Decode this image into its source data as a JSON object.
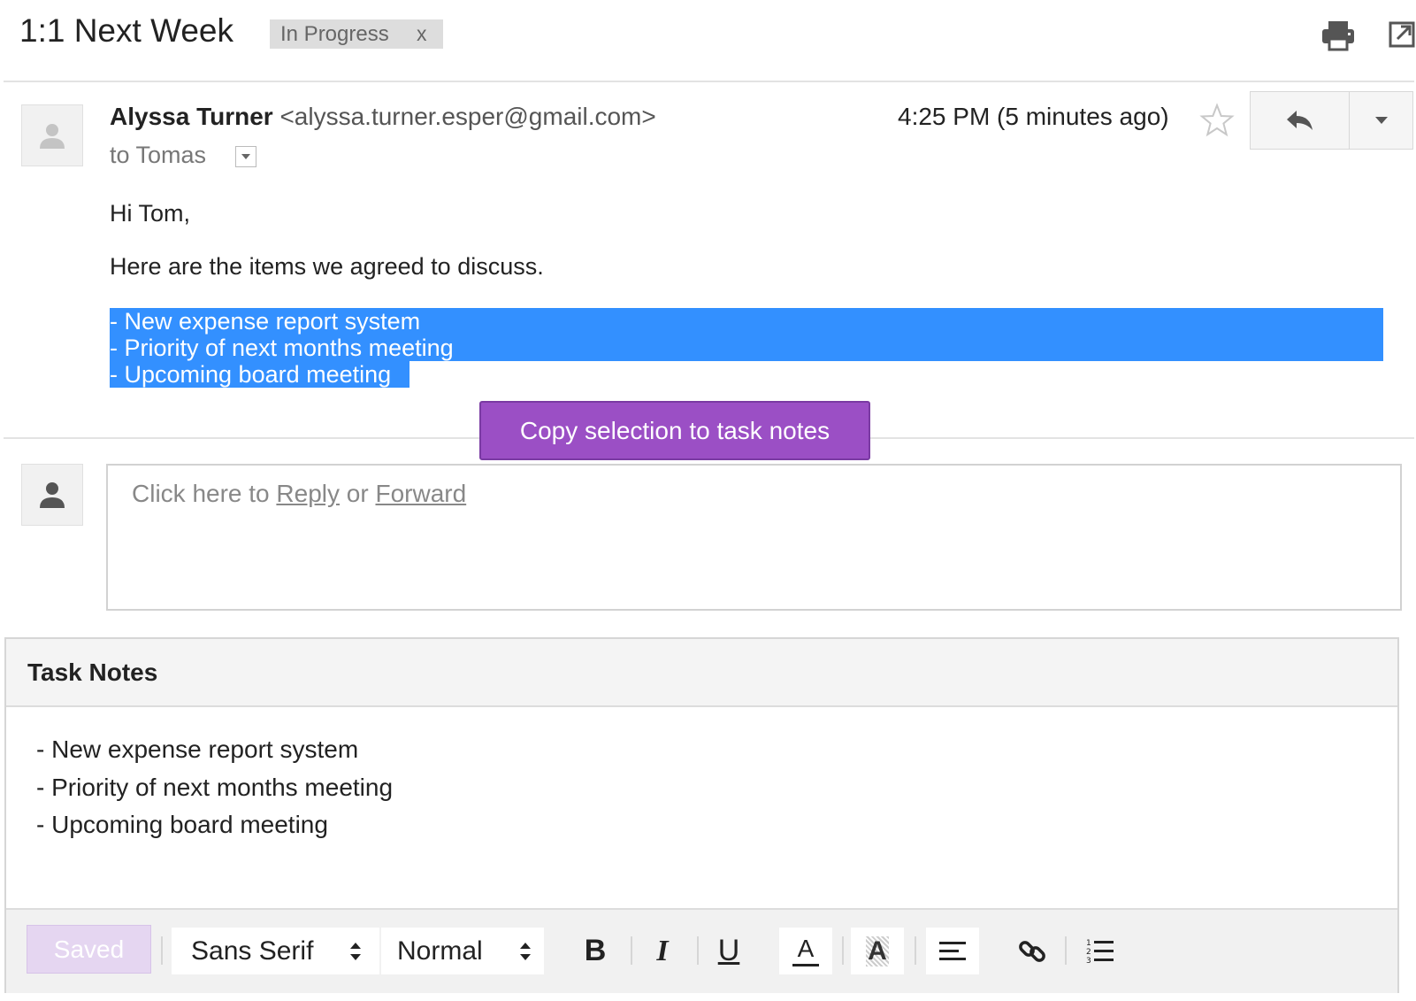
{
  "header": {
    "subject": "1:1 Next Week",
    "label": "In Progress",
    "label_remove": "x",
    "icons": [
      "print-icon",
      "open-in-new-window-icon"
    ]
  },
  "message": {
    "sender_name": "Alyssa Turner",
    "sender_email": "<alyssa.turner.esper@gmail.com>",
    "to_line": "to Tomas",
    "time": "4:25 PM (5 minutes ago)",
    "greeting": "Hi Tom,",
    "intro": "Here are the items we agreed to discuss.",
    "selected_lines": [
      "- New expense report system",
      "- Priority of next months meeting",
      "- Upcoming board meeting"
    ],
    "icons": [
      "avatar-icon",
      "star-icon",
      "reply-icon",
      "more-dropdown-icon"
    ]
  },
  "copy_button": {
    "label": "Copy selection to task notes"
  },
  "reply_box": {
    "prompt_prefix": "Click here to",
    "reply_link": "Reply",
    "or_text": "or",
    "forward_link": "Forward"
  },
  "task_notes": {
    "title": "Task Notes",
    "lines": [
      "- New expense report system",
      "- Priority of next months meeting",
      "- Upcoming board meeting"
    ],
    "toolbar": {
      "saved_label": "Saved",
      "font_family_value": "Sans Serif",
      "font_size_value": "Normal",
      "bold_label": "B",
      "italic_label": "I",
      "underline_label": "U",
      "text_color_label": "A",
      "highlight_label": "A",
      "icons": [
        "align-left-icon",
        "link-icon",
        "numbered-list-icon"
      ]
    }
  },
  "colors": {
    "selection": "#3390ff",
    "copy_button": "#9b4fc5",
    "saved_button": "#e5d6f1"
  }
}
